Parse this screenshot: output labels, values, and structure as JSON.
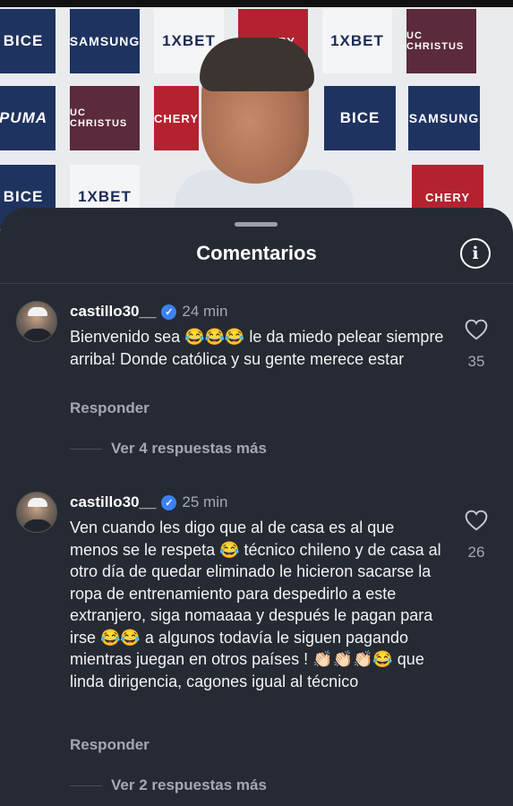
{
  "video": {
    "sponsor_tiles": [
      "BICE",
      "SAMSUNG",
      "1XBET",
      "CHERY",
      "1XBET",
      "UC CHRISTUS",
      "PUMA",
      "UC CHRISTUS",
      "CHERY",
      "BICE",
      "SAMSUNG",
      "BICE",
      "1XBET",
      "CHERY"
    ]
  },
  "sheet": {
    "title": "Comentarios",
    "info_icon": "info-icon"
  },
  "comments": [
    {
      "username": "castillo30__",
      "verified": true,
      "time": "24 min",
      "text": "Bienvenido sea 😂😂😂 le da miedo pelear siempre arriba! Donde católica y su gente merece estar",
      "reply_label": "Responder",
      "more_replies": "Ver 4 respuestas más",
      "likes": "35"
    },
    {
      "username": "castillo30__",
      "verified": true,
      "time": "25 min",
      "text": "Ven cuando les digo que al de casa es al que menos se le respeta 😂 técnico chileno y de casa al otro día de quedar eliminado le hicieron sacarse la ropa de entrenamiento para despedirlo a este extranjero, siga nomaaaa y después le pagan para irse 😂😂 a algunos todavía le siguen pagando mientras juegan en otros países ! 👏🏻👏🏻👏🏻😂 que linda dirigencia, cagones igual al técnico",
      "reply_label": "Responder",
      "more_replies": "Ver 2 respuestas más",
      "likes": "26"
    }
  ]
}
